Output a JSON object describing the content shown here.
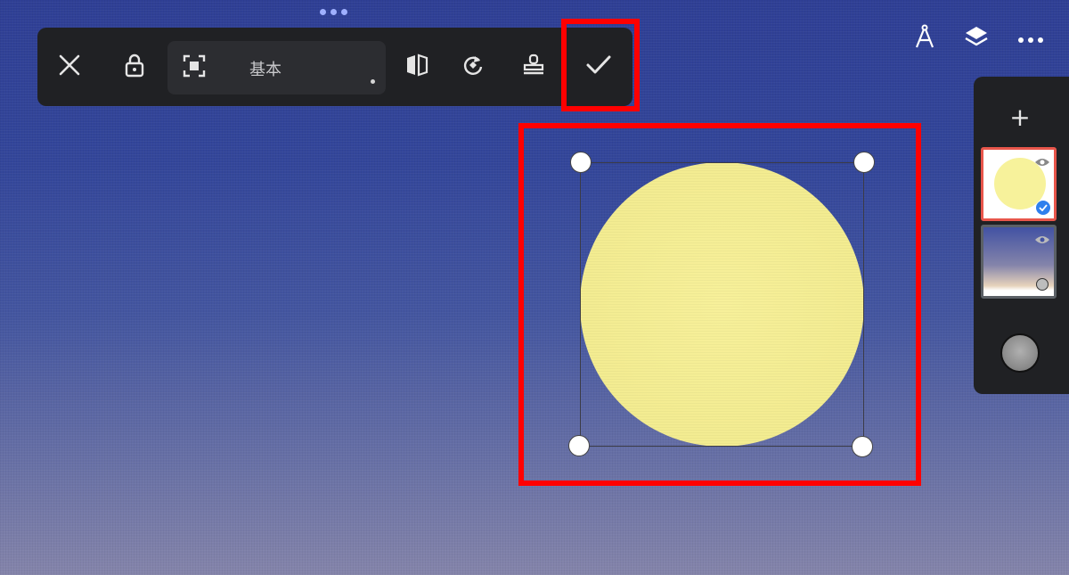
{
  "toolbar": {
    "mode_label": "基本"
  },
  "icons": {
    "close": "close-icon",
    "lock": "lock-icon",
    "fit": "fit-to-canvas-icon",
    "flip": "flip-icon",
    "rotate": "rotate-icon",
    "stamp": "stamp-icon",
    "confirm": "checkmark-icon",
    "ruler": "ruler-compass-icon",
    "layers": "layers-icon",
    "more": "more-icon",
    "add": "plus-icon",
    "visibility": "eye-icon"
  },
  "layers_panel": {
    "add_label": "+"
  },
  "colors": {
    "highlight": "#ff0000",
    "toolbar_bg": "#202124",
    "moon_fill": "#f7f09a",
    "selected_layer_border": "#e8564b"
  }
}
